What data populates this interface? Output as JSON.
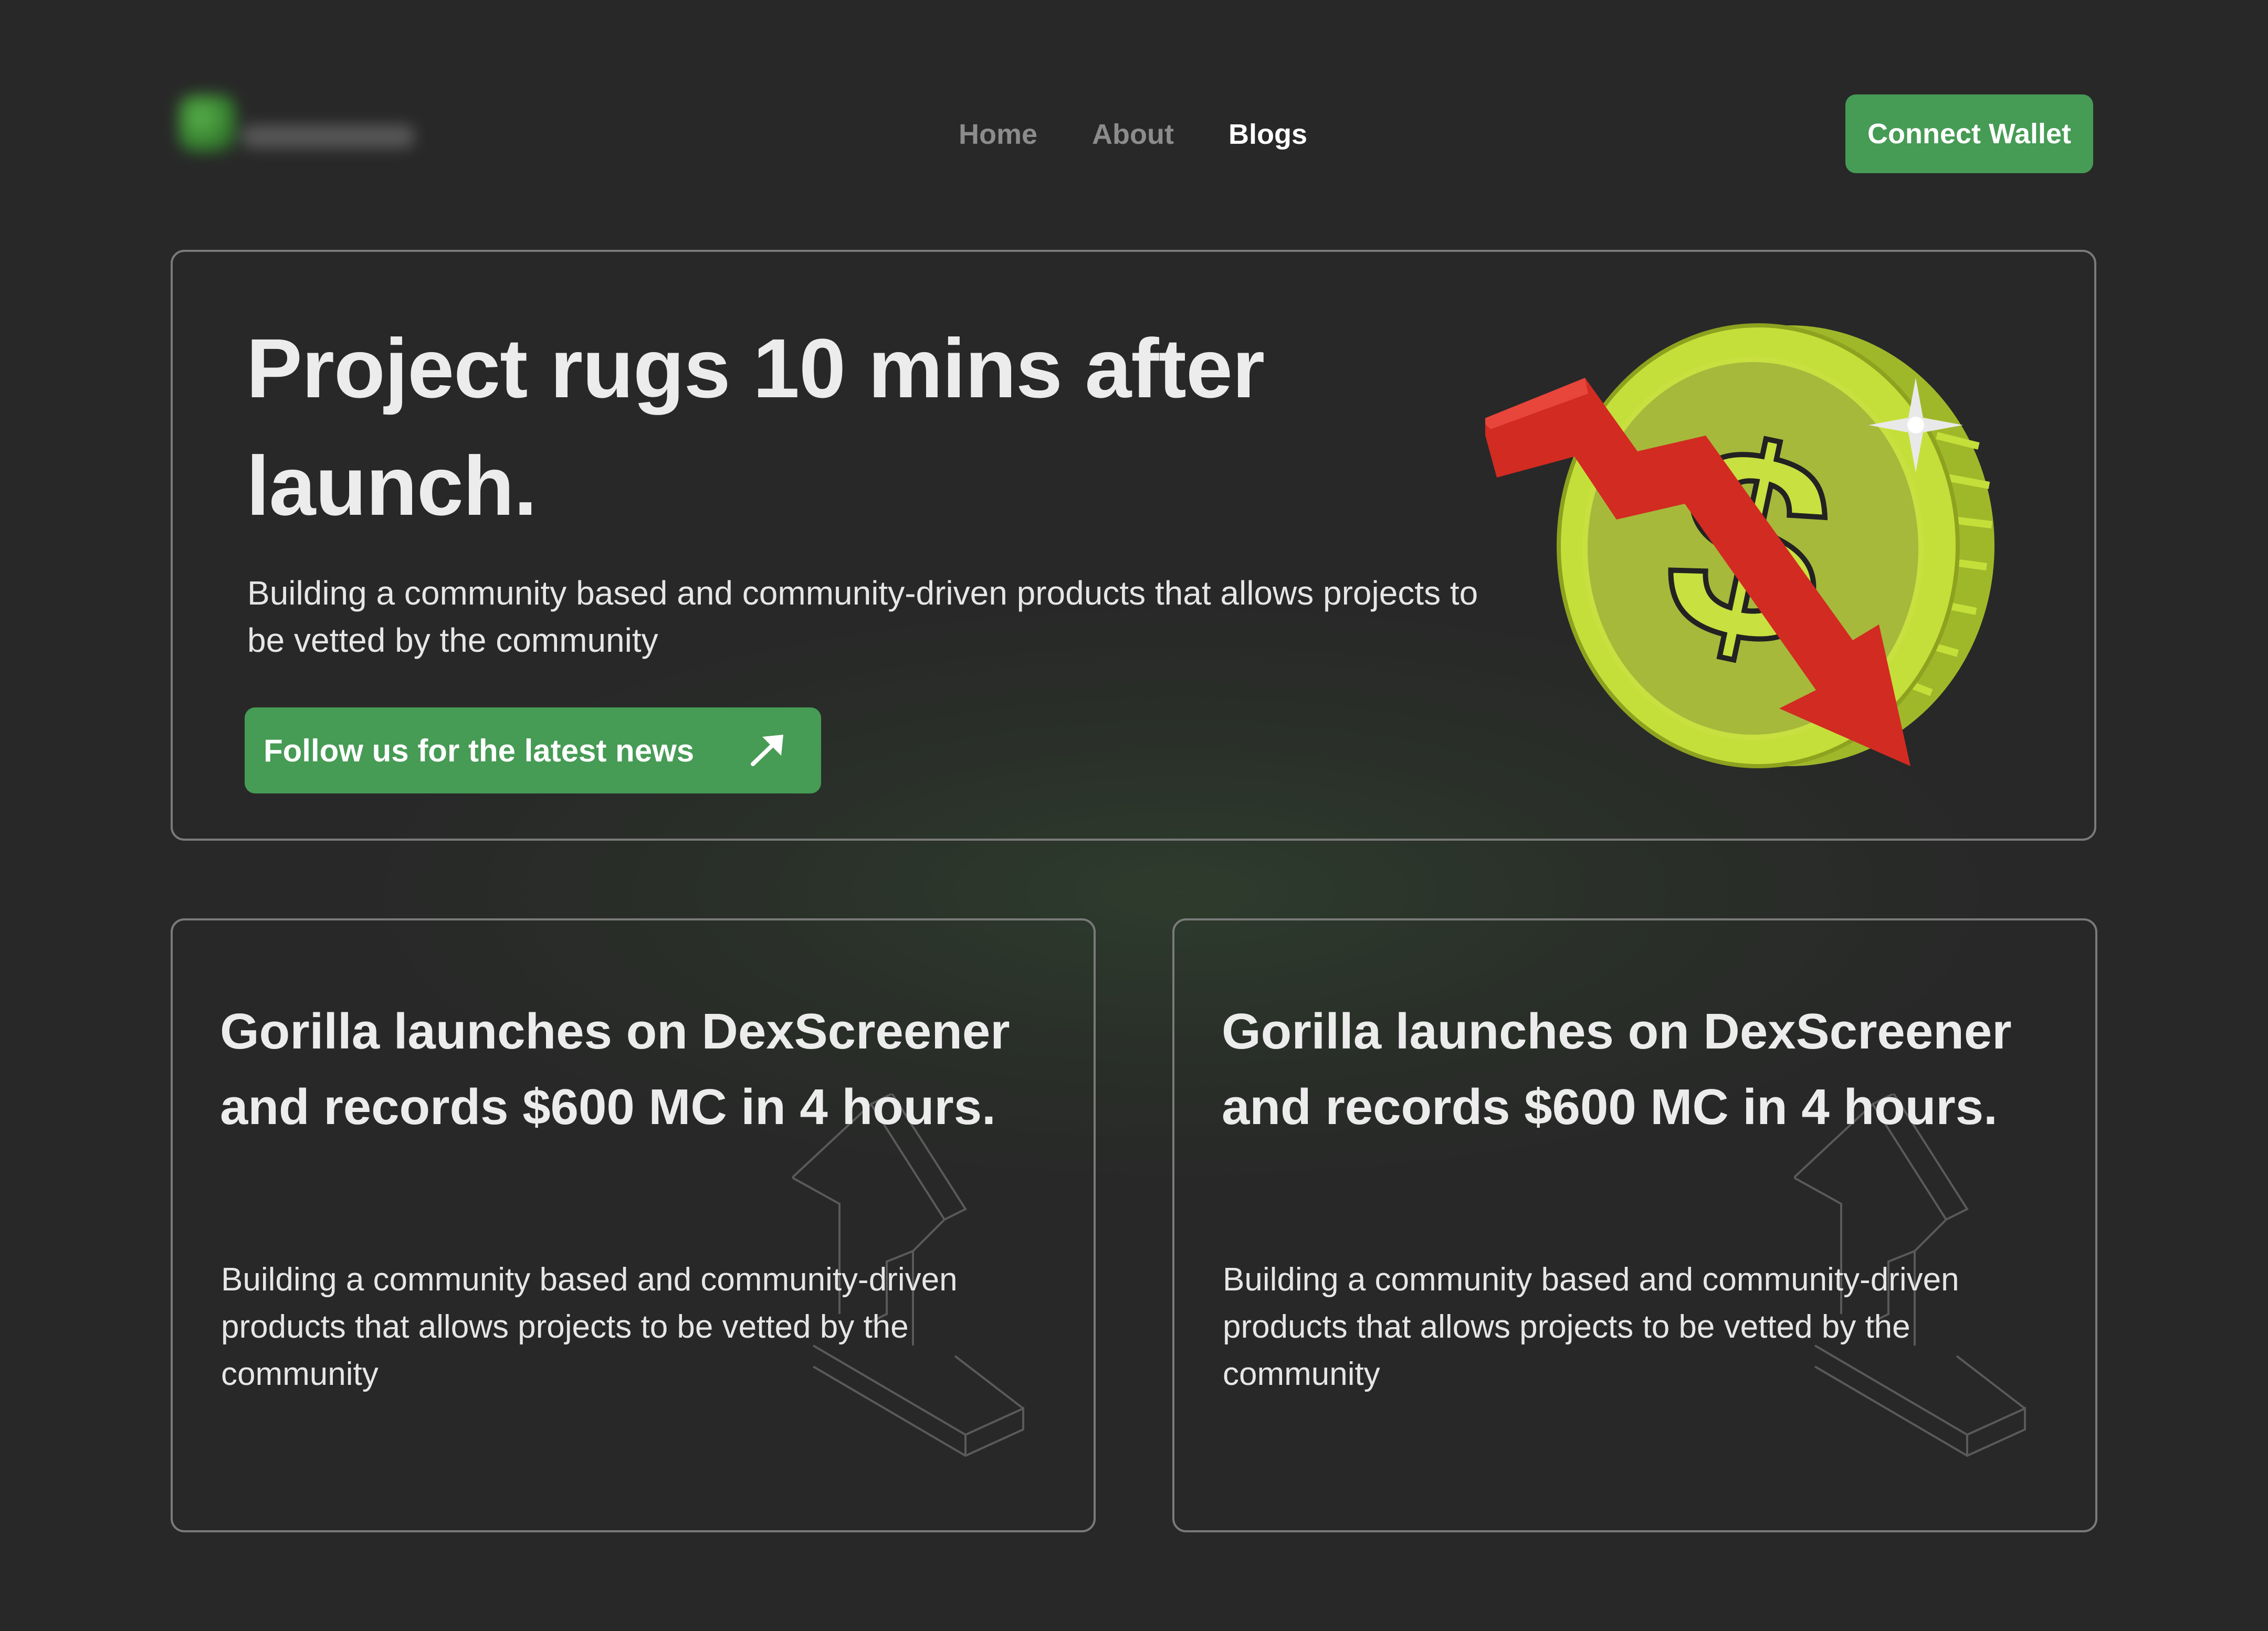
{
  "header": {
    "nav": [
      {
        "label": "Home",
        "active": false
      },
      {
        "label": "About",
        "active": false
      },
      {
        "label": "Blogs",
        "active": true
      }
    ],
    "connect_wallet_label": "Connect Wallet"
  },
  "hero": {
    "title": "Project rugs 10 mins after launch.",
    "description": "Building a community based and community-driven products that allows projects to be vetted by the community",
    "cta_label": "Follow us for the latest news",
    "cta_icon": "arrow-up-right-icon",
    "illustration_icon": "falling-dollar-coin-icon"
  },
  "cards": [
    {
      "title": "Gorilla launches on DexScreener and records $600 MC in 4 hours.",
      "description": "Building a community based and community-driven products that allows projects to be vetted by the community",
      "illustration_icon": "rising-arrow-outline-icon"
    },
    {
      "title": "Gorilla launches on DexScreener and records $600 MC in 4 hours.",
      "description": "Building a community based and community-driven products that allows projects to be vetted by the community",
      "illustration_icon": "rising-arrow-outline-icon"
    }
  ],
  "colors": {
    "background": "#282828",
    "accent_green": "#469b55",
    "card_border": "#7a7a7a",
    "nav_inactive": "#8c8c8c",
    "coin_green": "#c5df3a",
    "down_arrow_red": "#d22b22"
  }
}
